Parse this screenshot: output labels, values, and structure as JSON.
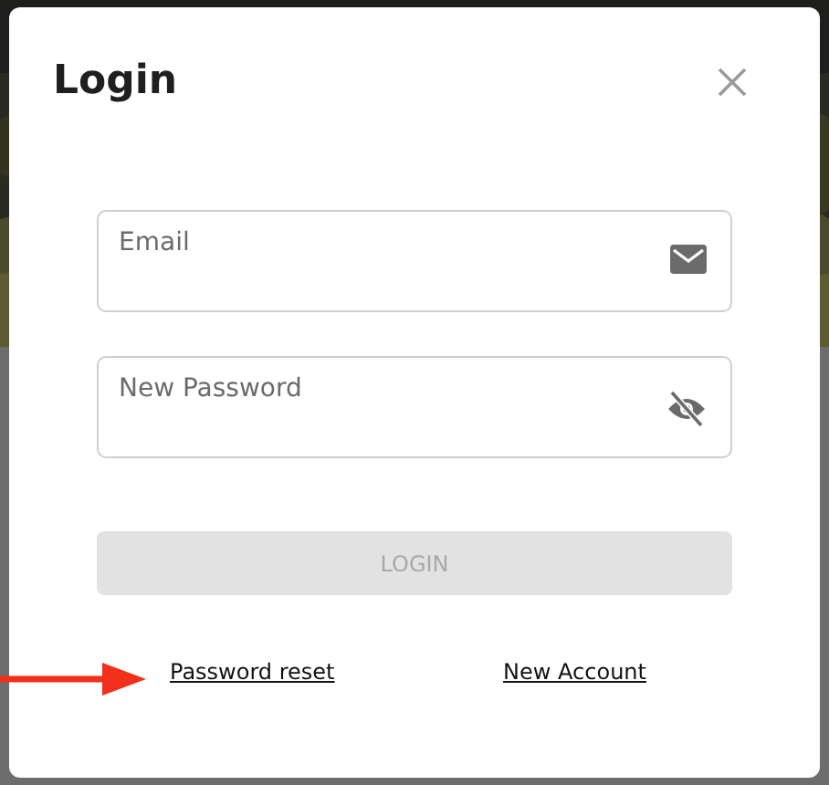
{
  "dialog": {
    "title": "Login",
    "fields": [
      {
        "kind": "email",
        "placeholder": "Email"
      },
      {
        "kind": "password",
        "placeholder": "New Password",
        "masked": true
      }
    ],
    "submit": {
      "label": "LOGIN",
      "disabled": true
    },
    "links": [
      "Password reset",
      "New Account"
    ]
  }
}
